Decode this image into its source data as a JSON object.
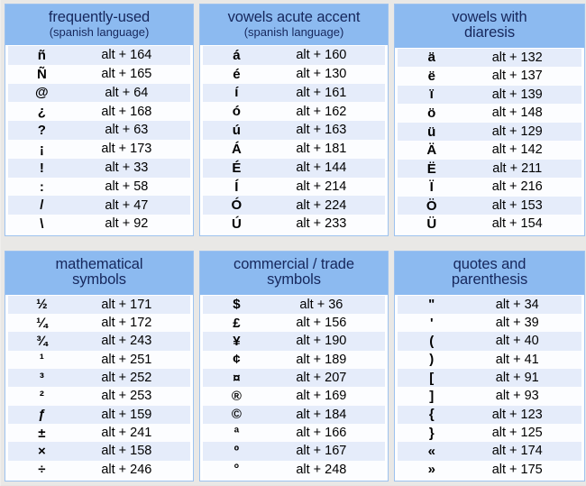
{
  "page": {
    "background_color": "#e9e8e6",
    "header_color": "#8cbaf0",
    "header_text_color": "#16275c",
    "row_odd_color": "#e5ecfa",
    "row_even_color": "#fcfdff",
    "border_color": "#9dc2ef"
  },
  "tables": [
    {
      "id": "frequently-used",
      "title": "frequently-used",
      "subtitle": "(spanish language)",
      "rows": [
        {
          "symbol": "ñ",
          "code": "alt + 164"
        },
        {
          "symbol": "Ñ",
          "code": "alt + 165"
        },
        {
          "symbol": "@",
          "code": "alt + 64"
        },
        {
          "symbol": "¿",
          "code": "alt + 168"
        },
        {
          "symbol": "?",
          "code": "alt + 63"
        },
        {
          "symbol": "¡",
          "code": "alt + 173"
        },
        {
          "symbol": "!",
          "code": "alt + 33"
        },
        {
          "symbol": ":",
          "code": "alt + 58"
        },
        {
          "symbol": "/",
          "code": "alt + 47"
        },
        {
          "symbol": "\\",
          "code": "alt + 92"
        }
      ]
    },
    {
      "id": "vowels-acute-accent",
      "title": "vowels acute accent",
      "subtitle": "(spanish language)",
      "rows": [
        {
          "symbol": "á",
          "code": "alt + 160"
        },
        {
          "symbol": "é",
          "code": "alt + 130"
        },
        {
          "symbol": "í",
          "code": "alt + 161"
        },
        {
          "symbol": "ó",
          "code": "alt + 162"
        },
        {
          "symbol": "ú",
          "code": "alt + 163"
        },
        {
          "symbol": "Á",
          "code": "alt + 181"
        },
        {
          "symbol": "É",
          "code": "alt + 144"
        },
        {
          "symbol": "Í",
          "code": "alt + 214"
        },
        {
          "symbol": "Ó",
          "code": "alt + 224"
        },
        {
          "symbol": "Ú",
          "code": "alt + 233"
        }
      ]
    },
    {
      "id": "vowels-with-diaresis",
      "title": "vowels with",
      "subtitle": "diaresis",
      "rows": [
        {
          "symbol": "ä",
          "code": "alt + 132"
        },
        {
          "symbol": "ë",
          "code": "alt + 137"
        },
        {
          "symbol": "ï",
          "code": "alt + 139"
        },
        {
          "symbol": "ö",
          "code": "alt + 148"
        },
        {
          "symbol": "ü",
          "code": "alt + 129"
        },
        {
          "symbol": "Ä",
          "code": "alt + 142"
        },
        {
          "symbol": "Ë",
          "code": "alt + 211"
        },
        {
          "symbol": "Ï",
          "code": "alt + 216"
        },
        {
          "symbol": "Ö",
          "code": "alt + 153"
        },
        {
          "symbol": "Ü",
          "code": "alt + 154"
        }
      ]
    },
    {
      "id": "mathematical-symbols",
      "title": "mathematical",
      "subtitle": "symbols",
      "rows": [
        {
          "symbol": "½",
          "code": "alt + 171"
        },
        {
          "symbol": "¼",
          "code": "alt + 172"
        },
        {
          "symbol": "¾",
          "code": "alt + 243"
        },
        {
          "symbol": "¹",
          "code": "alt + 251"
        },
        {
          "symbol": "³",
          "code": "alt + 252"
        },
        {
          "symbol": "²",
          "code": "alt + 253"
        },
        {
          "symbol": "ƒ",
          "code": "alt + 159"
        },
        {
          "symbol": "±",
          "code": "alt + 241"
        },
        {
          "symbol": "×",
          "code": "alt + 158"
        },
        {
          "symbol": "÷",
          "code": "alt + 246"
        }
      ]
    },
    {
      "id": "commercial-trade-symbols",
      "title": "commercial / trade",
      "subtitle": "symbols",
      "rows": [
        {
          "symbol": "$",
          "code": "alt + 36"
        },
        {
          "symbol": "£",
          "code": "alt + 156"
        },
        {
          "symbol": "¥",
          "code": "alt + 190"
        },
        {
          "symbol": "¢",
          "code": "alt + 189"
        },
        {
          "symbol": "¤",
          "code": "alt + 207"
        },
        {
          "symbol": "®",
          "code": "alt + 169"
        },
        {
          "symbol": "©",
          "code": "alt + 184"
        },
        {
          "symbol": "ª",
          "code": "alt + 166"
        },
        {
          "symbol": "º",
          "code": "alt + 167"
        },
        {
          "symbol": "°",
          "code": "alt + 248"
        }
      ]
    },
    {
      "id": "quotes-and-parenthesis",
      "title": "quotes and",
      "subtitle": "parenthesis",
      "rows": [
        {
          "symbol": "\"",
          "code": "alt + 34"
        },
        {
          "symbol": "'",
          "code": "alt + 39"
        },
        {
          "symbol": "(",
          "code": "alt + 40"
        },
        {
          "symbol": ")",
          "code": "alt + 41"
        },
        {
          "symbol": "[",
          "code": "alt + 91"
        },
        {
          "symbol": "]",
          "code": "alt + 93"
        },
        {
          "symbol": "{",
          "code": "alt + 123"
        },
        {
          "symbol": "}",
          "code": "alt + 125"
        },
        {
          "symbol": "«",
          "code": "alt + 174"
        },
        {
          "symbol": "»",
          "code": "alt + 175"
        }
      ]
    }
  ]
}
